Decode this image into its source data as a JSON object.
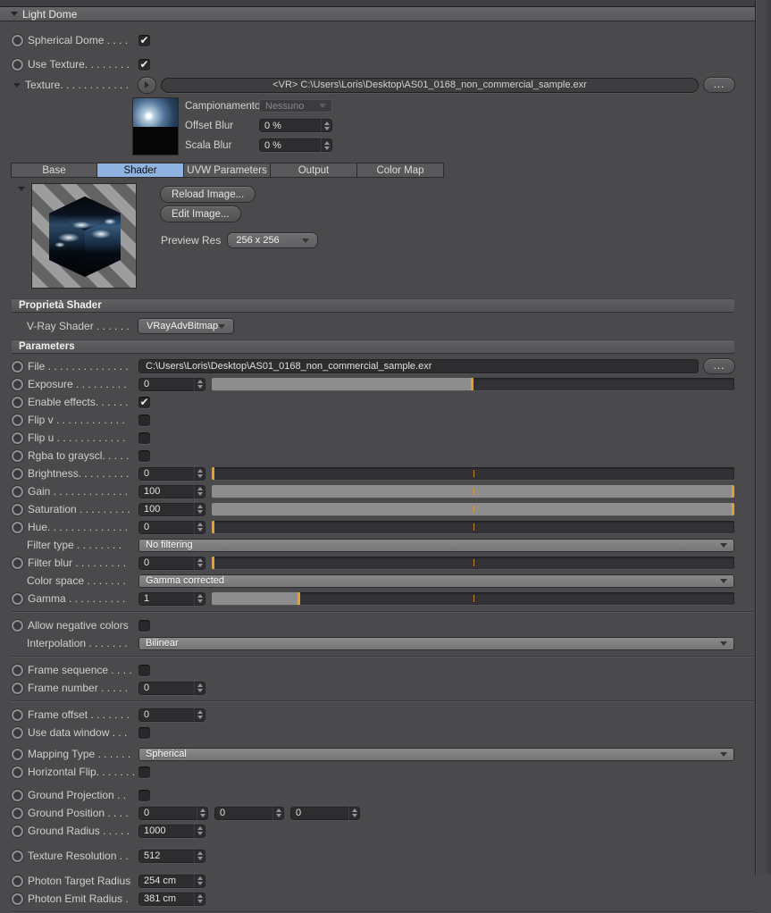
{
  "colors": {
    "tab_active": "#8fb3e0",
    "slider_handle": "#e5a02d",
    "slider_fill": "#8d8d8d",
    "background": "#4a4a4c"
  },
  "icons": {
    "panel_collapse": "triangle-down",
    "texture_expand": "triangle-down",
    "preview_collapse": "triangle-down",
    "texture_play": "triangle-right",
    "checkbox_check": "checkmark",
    "browse": "ellipsis-dots",
    "dropdown": "triangle-down",
    "stepper": "up-down-arrows"
  },
  "panel": {
    "title": "Light Dome"
  },
  "dome": {
    "spherical_dome": {
      "label": "Spherical Dome . . . .",
      "checked": true
    },
    "use_texture": {
      "label": "Use Texture. . . . . . . .",
      "checked": true
    },
    "texture": {
      "label": "Texture. . . . . . . . . . . .",
      "value": "<VR> C:\\Users\\Loris\\Desktop\\AS01_0168_non_commercial_sample.exr",
      "browse_label": "..."
    },
    "campionamento": {
      "label": "Campionamento",
      "value": "Nessuno",
      "disabled": true
    },
    "offset_blur": {
      "label": "Offset Blur",
      "value": "0 %"
    },
    "scala_blur": {
      "label": "Scala Blur",
      "value": "0 %"
    }
  },
  "tabs": {
    "items": [
      {
        "label": "Base",
        "active": false
      },
      {
        "label": "Shader",
        "active": true
      },
      {
        "label": "UVW Parameters",
        "active": false
      },
      {
        "label": "Output",
        "active": false
      },
      {
        "label": "Color Map",
        "active": false
      }
    ]
  },
  "preview": {
    "reload_button": "Reload Image...",
    "edit_button": "Edit Image...",
    "res_label": "Preview Res",
    "res_value": "256 x 256"
  },
  "shader_props": {
    "section_title": "Proprietà Shader",
    "vray_shader": {
      "label": "V-Ray Shader . . . . . .",
      "value": "VRayAdvBitmap"
    }
  },
  "parameters": {
    "section_title": "Parameters",
    "file": {
      "label": "File . . . . . . . . . . . . . .",
      "value": "C:\\Users\\Loris\\Desktop\\AS01_0168_non_commercial_sample.exr",
      "browse_label": "..."
    },
    "exposure": {
      "label": "Exposure . . . . . . . . .",
      "value": "0",
      "slider_pct": 50
    },
    "enable_effects": {
      "label": "Enable effects. . . . . .",
      "checked": true
    },
    "flip_v": {
      "label": "Flip v  . . . . . . . . . . . .",
      "checked": false
    },
    "flip_u": {
      "label": "Flip u  . . . . . . . . . . . .",
      "checked": false
    },
    "rgba_to_grayscl": {
      "label": "Rgba to grayscl. . . . .",
      "checked": false
    },
    "brightness": {
      "label": "Brightness. . . . . . . . .",
      "value": "0",
      "slider_pct": 0
    },
    "gain": {
      "label": "Gain  . . . . . . . . . . . . .",
      "value": "100",
      "slider_pct": 100
    },
    "saturation": {
      "label": "Saturation  . . . . . . . . .",
      "value": "100",
      "slider_pct": 100
    },
    "hue": {
      "label": "Hue. . . . . . . . . . . . . .",
      "value": "0",
      "slider_pct": 0
    },
    "filter_type": {
      "label": "Filter type  . . . . . . . .",
      "value": "No filtering"
    },
    "filter_blur": {
      "label": "Filter blur . . . . . . . . .",
      "value": "0",
      "slider_pct": 0
    },
    "color_space": {
      "label": "Color space . . . . . . .",
      "value": "Gamma corrected"
    },
    "gamma": {
      "label": "Gamma  . . . . . . . . . .",
      "value": "1",
      "slider_pct": 17
    },
    "allow_negative_colors": {
      "label": "Allow negative colors",
      "checked": false
    },
    "interpolation": {
      "label": "Interpolation . . . . . . .",
      "value": "Bilinear"
    },
    "frame_sequence": {
      "label": "Frame sequence . . . .",
      "checked": false
    },
    "frame_number": {
      "label": "Frame number  . . . . .",
      "value": "0"
    },
    "frame_offset": {
      "label": "Frame offset . . . . . . .",
      "value": "0"
    },
    "use_data_window": {
      "label": "Use data window  . . .",
      "checked": false
    },
    "mapping_type": {
      "label": "Mapping Type . . . . . .",
      "value": "Spherical"
    },
    "horizontal_flip": {
      "label": "Horizontal Flip. . . . . . .",
      "checked": false
    },
    "ground_projection": {
      "label": "Ground Projection  . .",
      "checked": false
    },
    "ground_position": {
      "label": "Ground Position  . . . .",
      "values": [
        "0",
        "0",
        "0"
      ]
    },
    "ground_radius": {
      "label": "Ground Radius  . . . . .",
      "value": "1000"
    },
    "texture_resolution": {
      "label": "Texture Resolution . .",
      "value": "512"
    },
    "photon_target_radius": {
      "label": "Photon Target Radius",
      "value": "254 cm"
    },
    "photon_emit_radius": {
      "label": "Photon Emit Radius .",
      "value": "381 cm"
    }
  }
}
